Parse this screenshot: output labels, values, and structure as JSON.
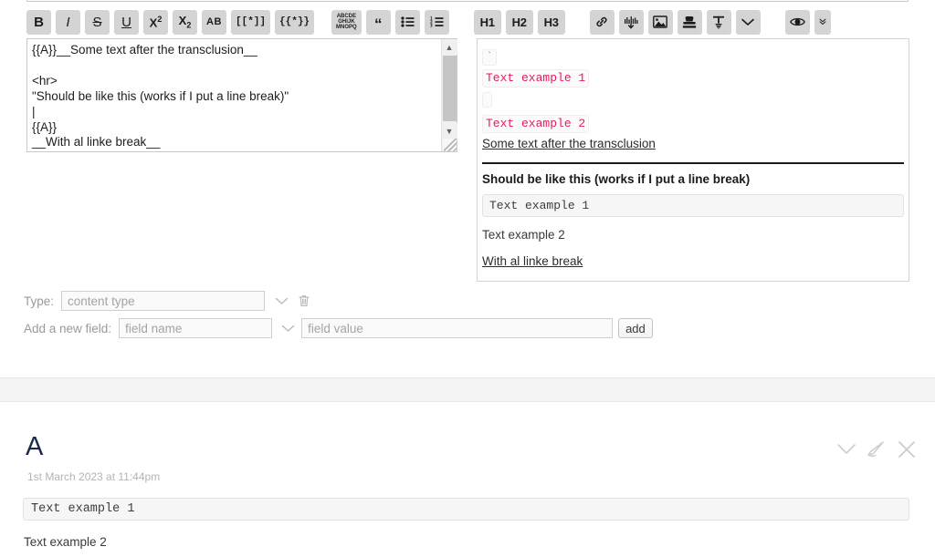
{
  "toolbar": {
    "buttons": [
      {
        "id": "bold",
        "label": "B",
        "icon": "bold-icon"
      },
      {
        "id": "italic",
        "label": "I",
        "icon": "italic-icon"
      },
      {
        "id": "strikethrough",
        "label": "S",
        "icon": "strikethrough-icon"
      },
      {
        "id": "underline",
        "label": "U",
        "icon": "underline-icon"
      },
      {
        "id": "superscript",
        "label": "X2",
        "icon": "superscript-icon"
      },
      {
        "id": "subscript",
        "label": "X2",
        "icon": "subscript-icon"
      },
      {
        "id": "monospace",
        "label": "AB",
        "icon": "monospace-icon"
      },
      {
        "id": "link-brackets",
        "label": "[[*]]",
        "icon": "wikilink-icon"
      },
      {
        "id": "transclusion",
        "label": "{{*}}",
        "icon": "transclusion-icon"
      },
      {
        "id": "abc-stanza",
        "label": "ABCDE",
        "icon": "abc-notation-icon"
      },
      {
        "id": "quote",
        "label": "“",
        "icon": "quote-icon"
      },
      {
        "id": "bullet-list",
        "label": "",
        "icon": "bullet-list-icon"
      },
      {
        "id": "numbered-list",
        "label": "",
        "icon": "numbered-list-icon"
      },
      {
        "id": "heading-1",
        "label": "H1",
        "icon": "heading-1-icon"
      },
      {
        "id": "heading-2",
        "label": "H2",
        "icon": "heading-2-icon"
      },
      {
        "id": "heading-3",
        "label": "H3",
        "icon": "heading-3-icon"
      },
      {
        "id": "link",
        "label": "",
        "icon": "link-icon"
      },
      {
        "id": "audio",
        "label": "",
        "icon": "audio-waveform-icon"
      },
      {
        "id": "image",
        "label": "",
        "icon": "image-icon"
      },
      {
        "id": "stamp",
        "label": "",
        "icon": "stamp-icon"
      },
      {
        "id": "text-tool",
        "label": "",
        "icon": "text-tool-icon"
      },
      {
        "id": "more",
        "label": "",
        "icon": "chevron-down-icon"
      },
      {
        "id": "preview",
        "label": "",
        "icon": "eye-icon"
      },
      {
        "id": "preview-more",
        "label": "",
        "icon": "double-chevron-down-icon"
      }
    ]
  },
  "editor": {
    "content": "{{A}}__Some text after the transclusion__\n\n<hr>\n\"Should be like this (works if I put a line break)\"\n|\n{{A}}\n__With al linke break__"
  },
  "preview": {
    "backtick": "`",
    "code_1": "Text example 1",
    "code_empty": "",
    "code_2": "Text example 2",
    "link_text": "Some text after the transclusion",
    "heading": "Should be like this (works if I put a line break)",
    "code_block": "Text example 1",
    "paragraph": "Text example 2",
    "link_2": "With al linke break"
  },
  "type_row": {
    "label": "Type:",
    "input_placeholder": "content type",
    "input_value": "",
    "dropdown_icon": "chevron-down-icon",
    "delete_icon": "trash-icon"
  },
  "field_row": {
    "label": "Add a new field:",
    "name_placeholder": "field name",
    "name_value": "",
    "dropdown_icon": "chevron-down-icon",
    "value_placeholder": "field value",
    "value_value": "",
    "add_label": "add"
  },
  "article": {
    "title": "A",
    "date": "1st March 2023 at 11:44pm",
    "code_block": "Text example 1",
    "paragraph": "Text example 2",
    "actions": [
      {
        "id": "collapse",
        "icon": "chevron-down-icon"
      },
      {
        "id": "edit",
        "icon": "pencil-icon"
      },
      {
        "id": "close",
        "icon": "close-icon"
      }
    ]
  },
  "colors": {
    "code_pink": "#e01e5a",
    "title_navy": "#1b2a4a",
    "toolbar_button": "#d4d4d4",
    "separator": "#f4f4f4"
  }
}
